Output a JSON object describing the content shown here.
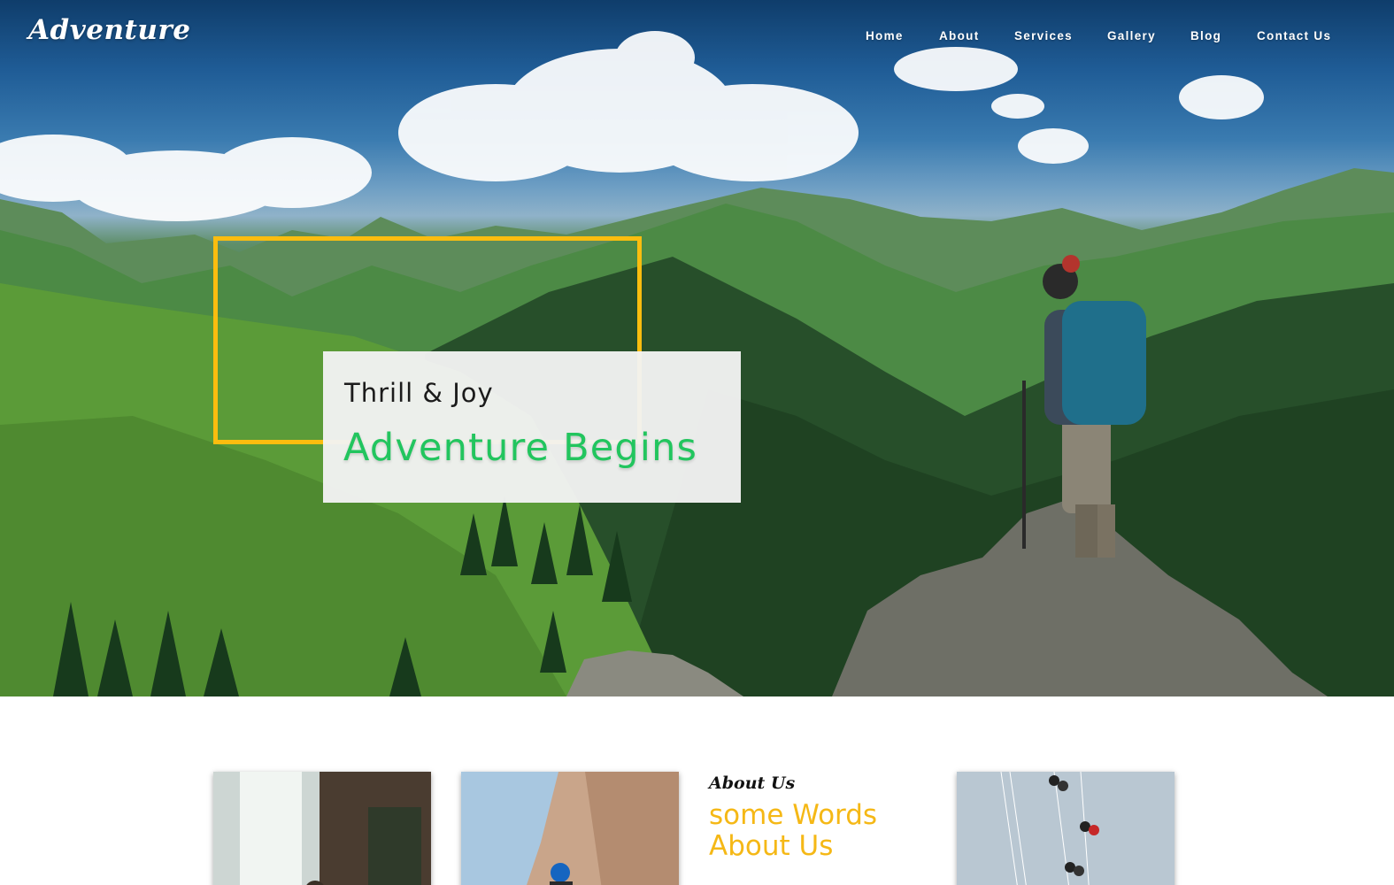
{
  "header": {
    "logo": "Adventure",
    "nav": [
      {
        "label": "Home"
      },
      {
        "label": "About"
      },
      {
        "label": "Services"
      },
      {
        "label": "Gallery"
      },
      {
        "label": "Blog"
      },
      {
        "label": "Contact Us"
      }
    ]
  },
  "hero": {
    "subtitle": "Thrill & Joy",
    "title": "Adventure Begins",
    "accent_color": "#22c55e",
    "frame_color": "#fbbd0f"
  },
  "about": {
    "kicker": "About Us",
    "heading_line1": "some Words",
    "heading_line2": "About Us",
    "heading_color": "#f5b816",
    "thumbnails": [
      "waterfall-photo",
      "climber-photo",
      "zipline-photo"
    ]
  }
}
